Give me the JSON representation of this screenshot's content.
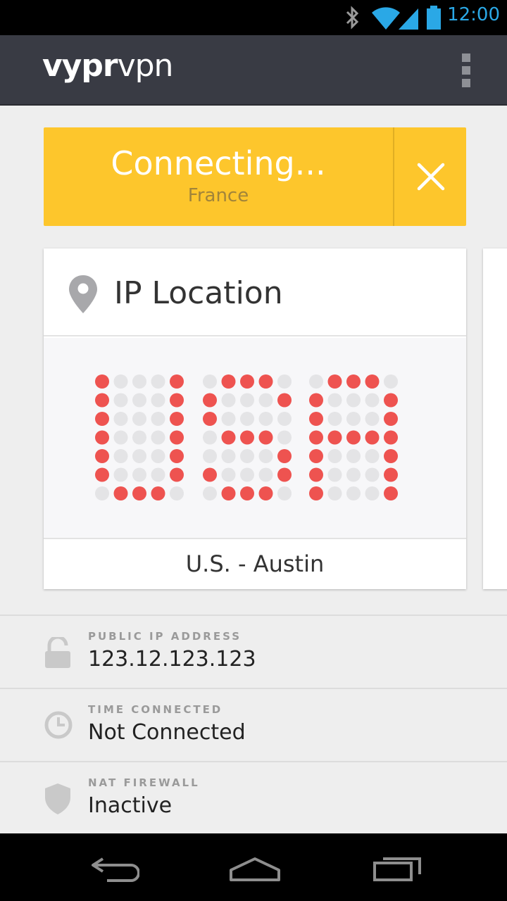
{
  "status_bar": {
    "time": "12:00",
    "time_color": "#2aa8e6",
    "icons": [
      "bluetooth-icon",
      "wifi-icon",
      "signal-icon",
      "battery-icon"
    ]
  },
  "app_bar": {
    "brand_bold": "vypr",
    "brand_light": "vpn",
    "menu_icon": "overflow-menu-icon",
    "background": "#393b44"
  },
  "connection": {
    "status": "Connecting...",
    "country": "France",
    "banner_color": "#fdc62c"
  },
  "ip_card": {
    "title": "IP Location",
    "display_text": "U.S. - Austin",
    "dot_on_color": "#ee5350",
    "dot_off_color": "#e4e4e6",
    "matrix_text": "US",
    "location": "U.S. - Austin"
  },
  "info": [
    {
      "label": "PUBLIC IP ADDRESS",
      "value": "123.12.123.123",
      "icon": "lock-icon"
    },
    {
      "label": "TIME CONNECTED",
      "value": "Not Connected",
      "icon": "clock-icon"
    },
    {
      "label": "NAT FIREWALL",
      "value": "Inactive",
      "icon": "shield-icon"
    }
  ],
  "nav_bar": {
    "icons": [
      "back-icon",
      "home-icon",
      "recents-icon"
    ]
  }
}
